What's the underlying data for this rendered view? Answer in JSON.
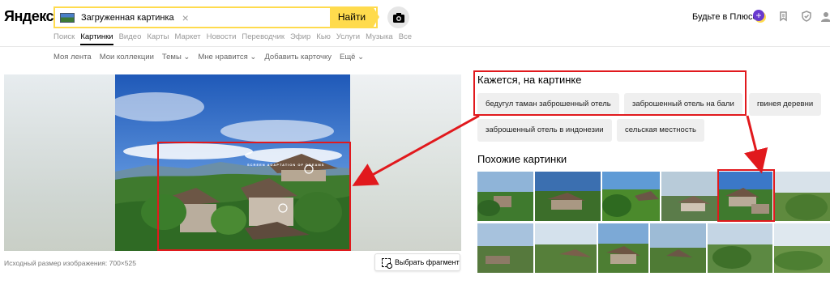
{
  "header": {
    "logo": "Яндекс",
    "search_value": "Загруженная картинка",
    "find_label": "Найти",
    "plus_label": "Будьте в Плюсе",
    "plus_badge": "+"
  },
  "services": [
    "Поиск",
    "Картинки",
    "Видео",
    "Карты",
    "Маркет",
    "Новости",
    "Переводчик",
    "Эфир",
    "Кью",
    "Услуги",
    "Музыка",
    "Все"
  ],
  "subnav": [
    "Моя лента",
    "Мои коллекции",
    "Темы ⌄",
    "Мне нравится ⌄",
    "Добавить карточку",
    "Ещё ⌄"
  ],
  "viewer": {
    "photo_caption": "SCREEN ADAPTATION OF DREAMS",
    "size_text": "Исходный размер изображения: 700×525",
    "fragment_button": "Выбрать фрагмент"
  },
  "tags": {
    "title": "Кажется, на картинке",
    "items": [
      "бедугул таман заброшенный отель",
      "заброшенный отель на бали",
      "гвинея деревни",
      "заброшенный отель в индонезии",
      "сельская местность"
    ]
  },
  "similar": {
    "title": "Похожие картинки"
  },
  "colors": {
    "accent_yellow": "#ffdb4d",
    "annotation_red": "#e1191d",
    "plus_purple": "#6839cf"
  },
  "icons": [
    "camera-icon",
    "clear-icon",
    "plus-badge-icon",
    "collections-icon",
    "shield-icon",
    "user-icon",
    "fragment-icon"
  ]
}
